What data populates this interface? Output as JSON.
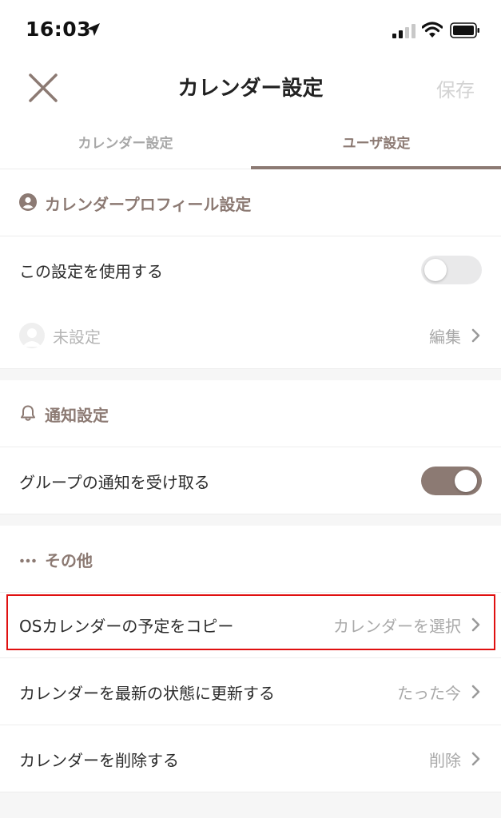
{
  "status_bar": {
    "time": "16:03"
  },
  "nav": {
    "title": "カレンダー設定",
    "save_label": "保存"
  },
  "tabs": [
    {
      "label": "カレンダー設定",
      "active": false
    },
    {
      "label": "ユーザ設定",
      "active": true
    }
  ],
  "profile_section": {
    "header": "カレンダープロフィール設定",
    "use_setting_label": "この設定を使用する",
    "use_setting_on": false,
    "profile_name": "未設定",
    "edit_label": "編集"
  },
  "notification_section": {
    "header": "通知設定",
    "group_notify_label": "グループの通知を受け取る",
    "group_notify_on": true
  },
  "other_section": {
    "header": "その他",
    "rows": [
      {
        "label": "OSカレンダーの予定をコピー",
        "value": "カレンダーを選択"
      },
      {
        "label": "カレンダーを最新の状態に更新する",
        "value": "たった今"
      },
      {
        "label": "カレンダーを削除する",
        "value": "削除"
      }
    ]
  },
  "colors": {
    "accent": "#8c7a73",
    "muted": "#a9a9a9",
    "highlight": "#e01010"
  }
}
